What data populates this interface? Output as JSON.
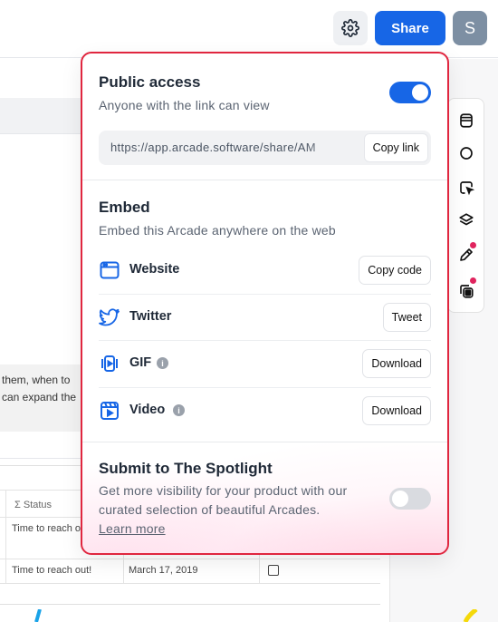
{
  "header": {
    "share_label": "Share",
    "avatar_letter": "S",
    "settings_icon": "gear-icon"
  },
  "background": {
    "note_lines": [
      "them, when to",
      "can expand the"
    ],
    "table": {
      "status_header": "Σ  Status",
      "rows": [
        {
          "status": "Time to reach o",
          "date": "",
          "checked": false
        },
        {
          "status": "Time to reach out!",
          "date": "March 17, 2019",
          "checked": false
        }
      ]
    },
    "toolbar_icons": [
      "layout-icon",
      "circle-icon",
      "cursor-icon",
      "layers-icon",
      "pencil-icon",
      "copy-icon"
    ]
  },
  "popover": {
    "public_access": {
      "title": "Public access",
      "subtitle": "Anyone with the link can view",
      "toggle_on": true,
      "link_url": "https://app.arcade.software/share/AM",
      "copy_link_label": "Copy link"
    },
    "embed": {
      "title": "Embed",
      "subtitle": "Embed this Arcade anywhere on the web",
      "items": [
        {
          "label": "Website",
          "icon": "browser-window-icon",
          "info": false,
          "action": "Copy code"
        },
        {
          "label": "Twitter",
          "icon": "twitter-icon",
          "info": false,
          "action": "Tweet"
        },
        {
          "label": "GIF",
          "icon": "gif-icon",
          "info": true,
          "action": "Download"
        },
        {
          "label": "Video",
          "icon": "video-icon",
          "info": true,
          "action": "Download"
        }
      ]
    },
    "spotlight": {
      "title": "Submit to The Spotlight",
      "description": "Get more visibility for your product with our curated selection of beautiful Arcades.",
      "learn_more": "Learn more",
      "toggle_on": false
    }
  },
  "colors": {
    "accent": "#1766e6",
    "highlight_border": "#e0263f",
    "notification_dot": "#e0245e"
  }
}
